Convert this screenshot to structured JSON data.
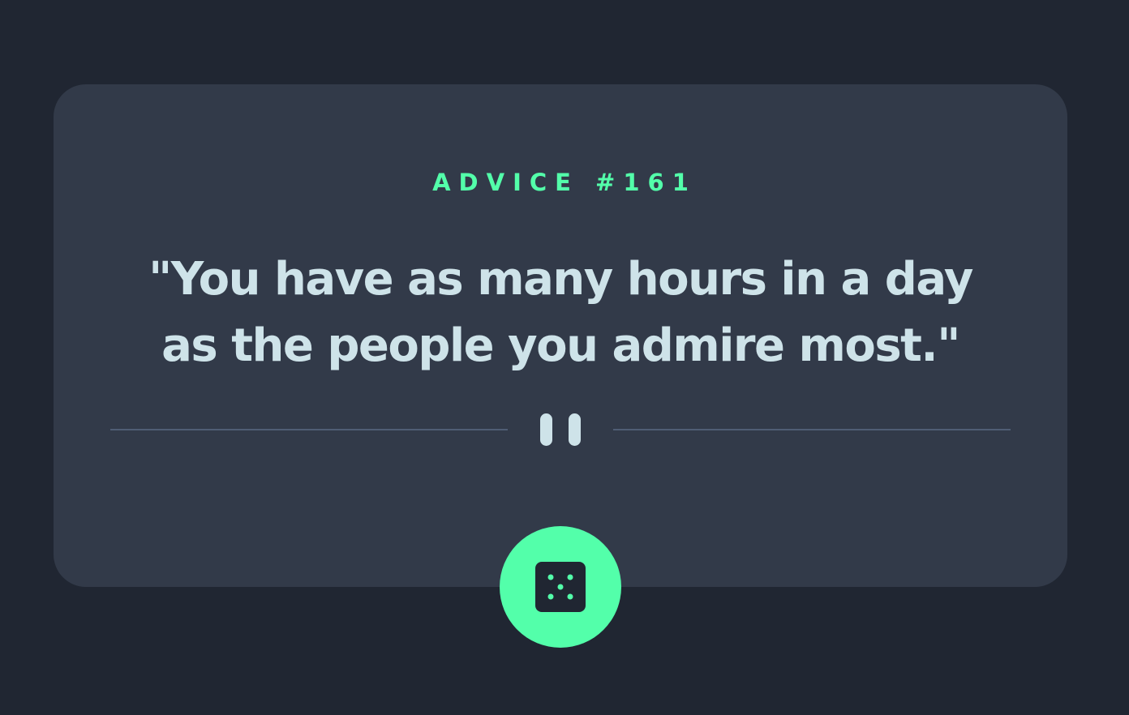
{
  "advice": {
    "label": "ADVICE #161",
    "quote": "\"You have as many hours in a day as the people you admire most.\""
  },
  "divider": {
    "icon": "pause-quote-icon"
  },
  "action": {
    "icon": "dice-icon"
  },
  "colors": {
    "background": "#202632",
    "card": "#323a49",
    "accent": "#53ffaa",
    "text": "#cee3e9",
    "divider_line": "#4f5d74"
  }
}
